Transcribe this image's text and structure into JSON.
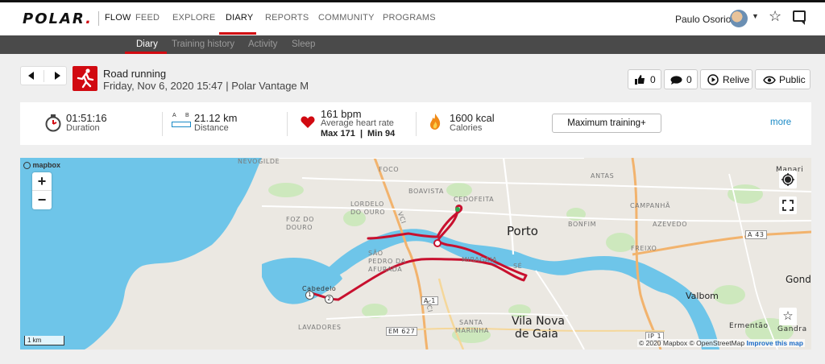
{
  "brand": {
    "logo_text": "POLAR",
    "logo_dot": "."
  },
  "nav": {
    "items": [
      "FLOW",
      "FEED",
      "EXPLORE",
      "DIARY",
      "REPORTS",
      "COMMUNITY",
      "PROGRAMS"
    ],
    "active": "DIARY"
  },
  "user": {
    "name": "Paulo Osorio"
  },
  "subnav": {
    "items": [
      "Diary",
      "Training history",
      "Activity",
      "Sleep"
    ],
    "active": "Diary"
  },
  "activity": {
    "sport": "Road running",
    "subtitle": "Friday, Nov 6, 2020 15:47 | Polar Vantage M",
    "likes": "0",
    "comments": "0",
    "relive_label": "Relive",
    "visibility_label": "Public"
  },
  "stats": {
    "duration_value": "01:51:16",
    "duration_label": "Duration",
    "distance_icon_a": "A",
    "distance_icon_b": "B",
    "distance_value": "21.12 km",
    "distance_label": "Distance",
    "hr_value": "161 bpm",
    "hr_label": "Average heart rate",
    "hr_max": "Max 171",
    "hr_sep": "|",
    "hr_min": "Min 94",
    "calories_value": "1600 kcal",
    "calories_label": "Calories",
    "benefit_label": "Maximum training+",
    "more_label": "more"
  },
  "map": {
    "logo": "mapbox",
    "scale_label": "1 km",
    "attribution_1": "© 2020 Mapbox © OpenStreetMap",
    "attribution_2": "Improve this map",
    "zoom_in": "+",
    "zoom_out": "−",
    "city_porto": "Porto",
    "city_gaia_1": "Vila Nova",
    "city_gaia_2": "de Gaia",
    "city_valbom": "Valbom",
    "city_gond": "Gond",
    "labels": {
      "nevogilde": "NEVOGILDE",
      "foco": "FOCO",
      "boavista": "BOAVISTA",
      "cedofeita": "CEDOFEITA",
      "antas": "ANTAS",
      "manari": "Manari",
      "lordelo1": "LORDELO",
      "lordelo2": "DO OURO",
      "foz1": "FOZ DO",
      "foz2": "DOURO",
      "bonfim": "BONFIM",
      "campanha": "CAMPANHÃ",
      "azevedo": "AZEVEDO",
      "freixo": "FREIXO",
      "sao1": "SÃO",
      "sao2": "PEDRO DA",
      "sao3": "AFURADA",
      "mira": "MIRAGAIA",
      "se": "SÉ",
      "cabedelo": "Cabedelo",
      "lavadores": "LAVADORES",
      "santa1": "SANTA",
      "santa2": "MARINHA",
      "ermentao": "Ermentão",
      "gandra": "Gandra",
      "a1": "A 1",
      "a43": "A 43",
      "em627": "EM 627",
      "ip1": "IP 1",
      "vci1": "VCI",
      "vci2": "VCI"
    },
    "marker_start": "1",
    "marker_end": "2"
  },
  "colors": {
    "brand_red": "#d10a11",
    "route": "#c8102e",
    "water": "#6ec5e9",
    "link": "#1a8ac6"
  },
  "icons": [
    "arrow-left-icon",
    "arrow-right-icon",
    "running-icon",
    "like-icon",
    "comment-icon",
    "play-icon",
    "eye-icon",
    "stopwatch-icon",
    "distance-icon",
    "heart-icon",
    "flame-icon",
    "star-icon",
    "message-icon",
    "locate-icon",
    "fullscreen-icon"
  ]
}
